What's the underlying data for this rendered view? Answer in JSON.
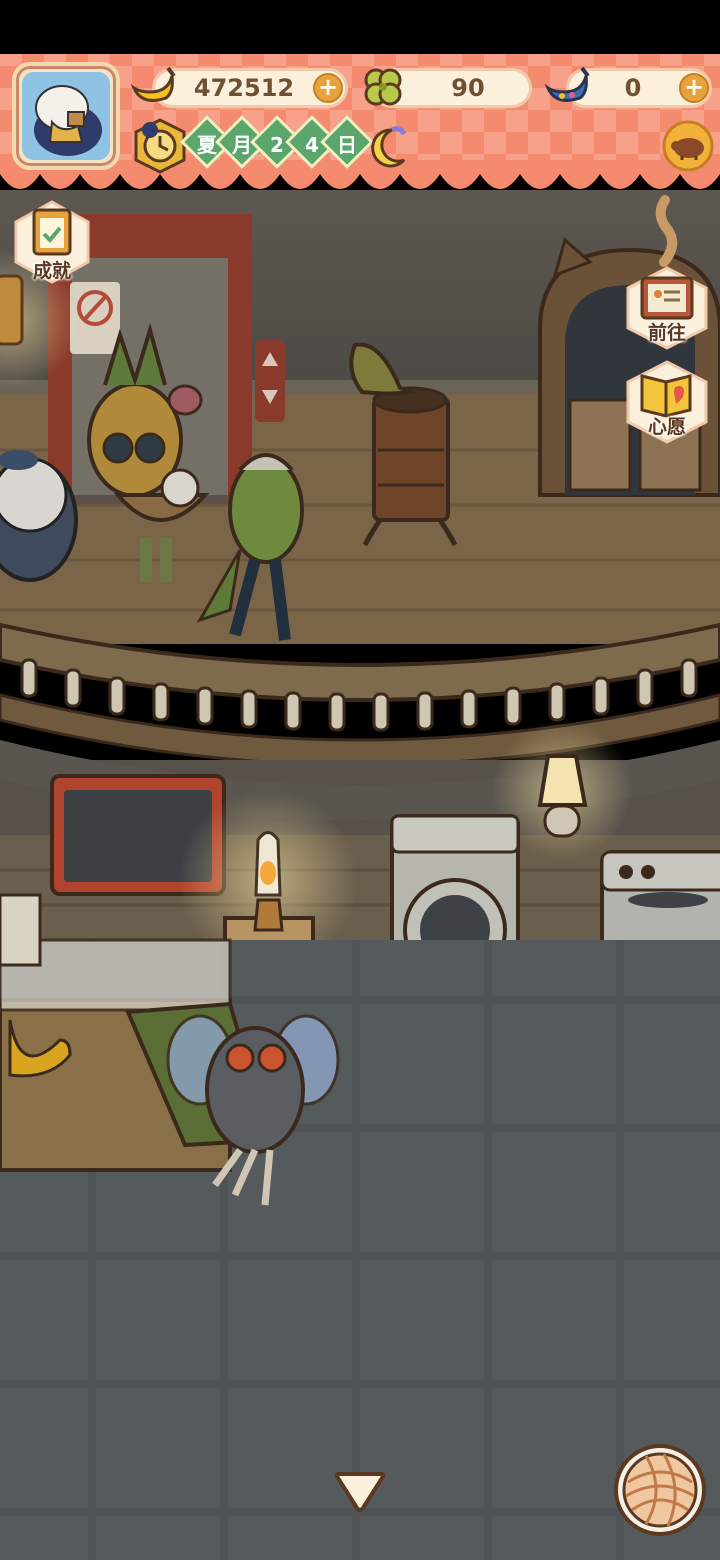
{
  "hud": {
    "bananas": {
      "value": "472512",
      "icon": "banana-icon"
    },
    "clovers": {
      "value": "90",
      "icon": "clover-icon"
    },
    "rainbow_bananas": {
      "value": "0",
      "icon": "rainbow-banana-icon"
    },
    "date": {
      "season": "夏",
      "month_label": "月",
      "day_digit_1": "2",
      "day_digit_2": "4",
      "day_label": "日"
    },
    "time_icon": "night-moon-icon",
    "clock_icon": "clock-icon",
    "pig_icon": "boar-icon"
  },
  "side_buttons": {
    "achievements": {
      "label": "成就",
      "icon": "clipboard-check-icon"
    },
    "go": {
      "label": "前往",
      "icon": "map-board-icon"
    },
    "wish": {
      "label": "心愿",
      "icon": "heart-book-icon"
    }
  },
  "bottom": {
    "collapse_icon": "triangle-down-icon",
    "yarn_icon": "yarn-ball-icon"
  },
  "colors": {
    "banner": "#f48a6e",
    "banner_check": "#f7a58f",
    "panel_cream": "#fbf0dc",
    "floor_dark": "#4b4f52",
    "stage_wood": "#8a6e4a",
    "accent_orange": "#e8a23c",
    "date_green": "#5aa66c"
  }
}
